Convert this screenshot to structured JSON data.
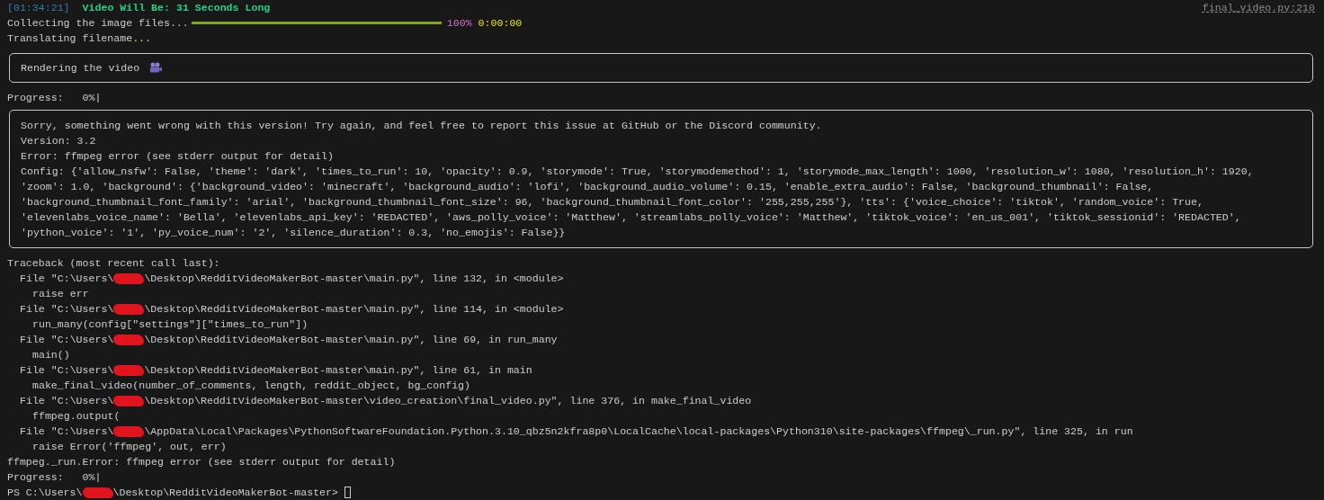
{
  "header": {
    "timestamp": "[01:34:21]",
    "message": "Video Will Be: 31 Seconds Long",
    "source_link": "final_video.py:210"
  },
  "collect_task": {
    "label": "Collecting the image files...",
    "level": 1,
    "percent": "100%",
    "elapsed": "0:00:00"
  },
  "translate_task": {
    "label": "Translating filename",
    "dots": "..."
  },
  "render_panel": {
    "text": "Rendering the video"
  },
  "progress_first": "Progress:   0%|",
  "error_panel": {
    "lines": [
      "Sorry, something went wrong with this version! Try again, and feel free to report this issue at GitHub or the Discord community.",
      "Version: 3.2",
      "Error: ffmpeg error (see stderr output for detail)",
      "Config: {'allow_nsfw': False, 'theme': 'dark', 'times_to_run': 10, 'opacity': 0.9, 'storymode': True, 'storymodemethod': 1, 'storymode_max_length': 1000, 'resolution_w': 1080, 'resolution_h': 1920,",
      "'zoom': 1.0, 'background': {'background_video': 'minecraft', 'background_audio': 'lofi', 'background_audio_volume': 0.15, 'enable_extra_audio': False, 'background_thumbnail': False,",
      "'background_thumbnail_font_family': 'arial', 'background_thumbnail_font_size': 96, 'background_thumbnail_font_color': '255,255,255'}, 'tts': {'voice_choice': 'tiktok', 'random_voice': True,",
      "'elevenlabs_voice_name': 'Bella', 'elevenlabs_api_key': 'REDACTED', 'aws_polly_voice': 'Matthew', 'streamlabs_polly_voice': 'Matthew', 'tiktok_voice': 'en_us_001', 'tiktok_sessionid': 'REDACTED',",
      "'python_voice': '1', 'py_voice_num': '2', 'silence_duration': 0.3, 'no_emojis': False}}"
    ]
  },
  "traceback": {
    "title": "Traceback (most recent call last):",
    "frames": [
      {
        "path_start": "File \"C:\\Users\\",
        "path_end": "\\Desktop\\RedditVideoMakerBot-master\\main.py\", line 132, in <module>",
        "code": "raise err"
      },
      {
        "path_start": "File \"C:\\Users\\",
        "path_end": "\\Desktop\\RedditVideoMakerBot-master\\main.py\", line 114, in <module>",
        "code": "run_many(config[\"settings\"][\"times_to_run\"])"
      },
      {
        "path_start": "File \"C:\\Users\\",
        "path_end": "\\Desktop\\RedditVideoMakerBot-master\\main.py\", line 69, in run_many",
        "code": "main()"
      },
      {
        "path_start": "File \"C:\\Users\\",
        "path_end": "\\Desktop\\RedditVideoMakerBot-master\\main.py\", line 61, in main",
        "code": "make_final_video(number_of_comments, length, reddit_object, bg_config)"
      },
      {
        "path_start": "File \"C:\\Users\\",
        "path_end": "\\Desktop\\RedditVideoMakerBot-master\\video_creation\\final_video.py\", line 376, in make_final_video",
        "code": "ffmpeg.output("
      },
      {
        "path_start": "File \"C:\\Users\\",
        "path_end": "\\AppData\\Local\\Packages\\PythonSoftwareFoundation.Python.3.10_qbz5n2kfra8p0\\LocalCache\\local-packages\\Python310\\site-packages\\ffmpeg\\_run.py\", line 325, in run",
        "code": "raise Error('ffmpeg', out, err)"
      }
    ],
    "error": "ffmpeg._run.Error: ffmpeg error (see stderr output for detail)"
  },
  "progress_second": "Progress:   0%|",
  "prompt": {
    "prefix": "PS C:\\Users\\",
    "suffix": "\\Desktop\\RedditVideoMakerBot-master>"
  }
}
